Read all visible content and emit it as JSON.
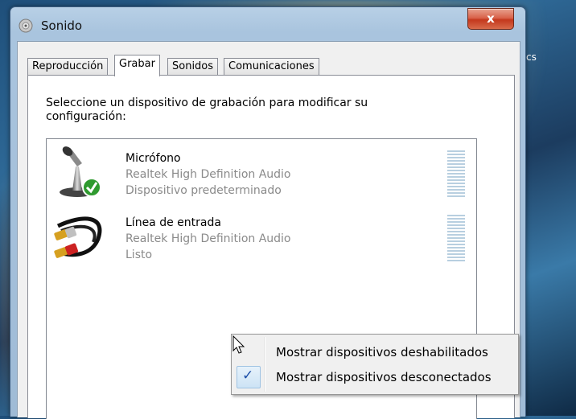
{
  "window": {
    "title": "Sonido",
    "close_glyph": "x"
  },
  "desktop": {
    "fragment_text": "cs"
  },
  "tabs": [
    {
      "label": "Reproducción",
      "active": false
    },
    {
      "label": "Grabar",
      "active": true
    },
    {
      "label": "Sonidos",
      "active": false
    },
    {
      "label": "Comunicaciones",
      "active": false
    }
  ],
  "panel": {
    "instruction": "Seleccione un dispositivo de grabación para modificar su configuración:"
  },
  "devices": [
    {
      "name": "Micrófono",
      "driver": "Realtek High Definition Audio",
      "status": "Dispositivo predeterminado",
      "icon": "microphone-icon",
      "default": true
    },
    {
      "name": "Línea de entrada",
      "driver": "Realtek High Definition Audio",
      "status": "Listo",
      "icon": "rca-cable-icon",
      "default": false
    }
  ],
  "context_menu": {
    "items": [
      {
        "label": "Mostrar dispositivos deshabilitados",
        "checked": false
      },
      {
        "label": "Mostrar dispositivos desconectados",
        "checked": true
      }
    ],
    "check_glyph": "✓"
  },
  "colors": {
    "accent": "#1d4fa8",
    "close_button": "#c4381d",
    "default_check": "#3aa33a"
  }
}
